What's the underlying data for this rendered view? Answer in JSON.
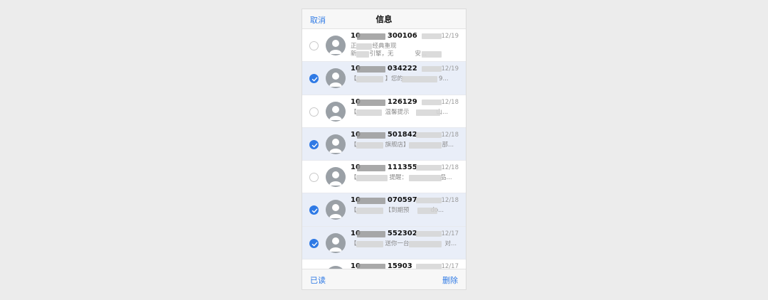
{
  "nav": {
    "cancel_label": "取消",
    "title": "信息"
  },
  "messages": [
    {
      "sender": "10",
      "sender_tail": "300106",
      "date": "12/19",
      "preview1": "正",
      "preview1b": "经典重现",
      "preview2": "新",
      "preview2b": "引擎，无",
      "preview2c": "安...",
      "selected": false
    },
    {
      "sender": "10",
      "sender_tail": "034222",
      "date": "12/19",
      "preview1": "【",
      "preview1b": "】您的",
      "preview1c": "9...",
      "selected": true
    },
    {
      "sender": "10",
      "sender_tail": "126129",
      "date": "12/18",
      "preview1": "【",
      "preview1b": "温馨提示",
      "preview1c": "山...",
      "selected": false
    },
    {
      "sender": "10",
      "sender_tail": "501842",
      "date": "12/18",
      "preview1": "【",
      "preview1b": "旗舰店】",
      "preview1c": "部...",
      "selected": true
    },
    {
      "sender": "10",
      "sender_tail": "111355",
      "date": "12/18",
      "preview1": "【",
      "preview1b": "提醒：",
      "preview1c": "品...",
      "selected": false
    },
    {
      "sender": "10",
      "sender_tail": "070597",
      "date": "12/18",
      "preview1": "【",
      "preview1b": "【到期预",
      "preview1c": "do...",
      "selected": true
    },
    {
      "sender": "10",
      "sender_tail": "552302",
      "date": "12/17",
      "preview1": "【",
      "preview1b": "送你一台",
      "preview1c": "对...",
      "selected": true
    },
    {
      "sender": "10",
      "sender_tail": "15903",
      "date": "12/17",
      "preview1": "",
      "preview1b": "",
      "preview1c": "",
      "selected": false
    }
  ],
  "toolbar": {
    "read_label": "已读",
    "delete_label": "删除"
  },
  "colors": {
    "accent": "#2f7ae5",
    "selected_row": "#e9eef8"
  }
}
